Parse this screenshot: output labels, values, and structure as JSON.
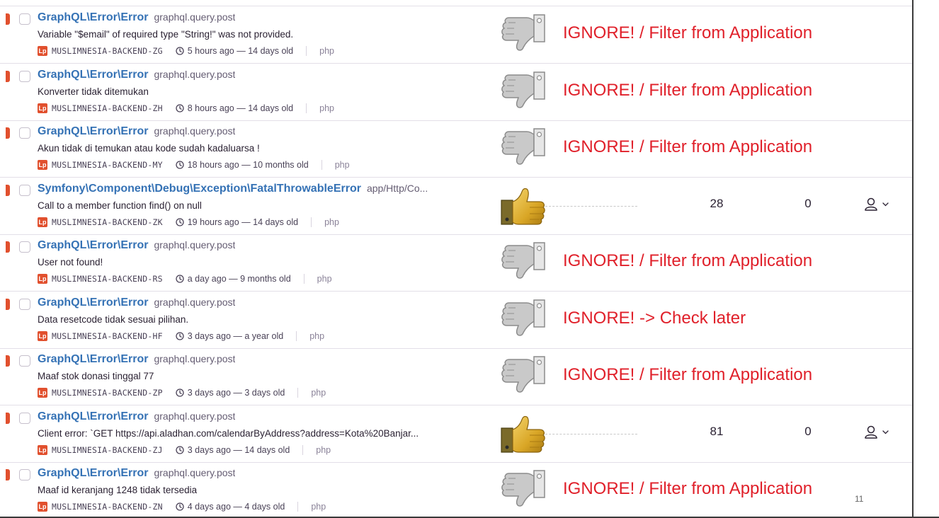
{
  "issues": [
    {
      "title": "GraphQL\\Error\\Error",
      "culprit": "graphql.query.post",
      "message": "Variable \"$email\" of required type \"String!\" was not provided.",
      "project_icon": "Lp",
      "short_id": "MUSLIMNESIA-BACKEND-ZG",
      "age": "5 hours ago — 14 days old",
      "platform": "php",
      "vote": "thumbs-down",
      "annotation": "IGNORE! / Filter from Application",
      "events": "",
      "users": ""
    },
    {
      "title": "GraphQL\\Error\\Error",
      "culprit": "graphql.query.post",
      "message": "Konverter tidak ditemukan",
      "project_icon": "Lp",
      "short_id": "MUSLIMNESIA-BACKEND-ZH",
      "age": "8 hours ago — 14 days old",
      "platform": "php",
      "vote": "thumbs-down",
      "annotation": "IGNORE! / Filter from Application",
      "events": "",
      "users": ""
    },
    {
      "title": "GraphQL\\Error\\Error",
      "culprit": "graphql.query.post",
      "message": "Akun tidak di temukan atau kode sudah kadaluarsa !",
      "project_icon": "Lp",
      "short_id": "MUSLIMNESIA-BACKEND-MY",
      "age": "18 hours ago — 10 months old",
      "platform": "php",
      "vote": "thumbs-down",
      "annotation": "IGNORE! / Filter from Application",
      "events": "",
      "users": ""
    },
    {
      "title": "Symfony\\Component\\Debug\\Exception\\FatalThrowableError",
      "culprit": "app/Http/Co...",
      "message": "Call to a member function find() on null",
      "project_icon": "Lp",
      "short_id": "MUSLIMNESIA-BACKEND-ZK",
      "age": "19 hours ago — 14 days old",
      "platform": "php",
      "vote": "thumbs-up",
      "annotation": "",
      "events": "28",
      "users": "0"
    },
    {
      "title": "GraphQL\\Error\\Error",
      "culprit": "graphql.query.post",
      "message": "User not found!",
      "project_icon": "Lp",
      "short_id": "MUSLIMNESIA-BACKEND-RS",
      "age": "a day ago — 9 months old",
      "platform": "php",
      "vote": "thumbs-down",
      "annotation": "IGNORE! / Filter from Application",
      "events": "",
      "users": ""
    },
    {
      "title": "GraphQL\\Error\\Error",
      "culprit": "graphql.query.post",
      "message": "Data resetcode tidak sesuai pilihan.",
      "project_icon": "Lp",
      "short_id": "MUSLIMNESIA-BACKEND-HF",
      "age": "3 days ago — a year old",
      "platform": "php",
      "vote": "thumbs-down",
      "annotation": "IGNORE! -> Check later",
      "events": "",
      "users": ""
    },
    {
      "title": "GraphQL\\Error\\Error",
      "culprit": "graphql.query.post",
      "message": "Maaf stok donasi tinggal 77",
      "project_icon": "Lp",
      "short_id": "MUSLIMNESIA-BACKEND-ZP",
      "age": "3 days ago — 3 days old",
      "platform": "php",
      "vote": "thumbs-down",
      "annotation": "IGNORE! / Filter from Application",
      "events": "",
      "users": ""
    },
    {
      "title": "GraphQL\\Error\\Error",
      "culprit": "graphql.query.post",
      "message": "Client error: `GET https://api.aladhan.com/calendarByAddress?address=Kota%20Banjar...",
      "project_icon": "Lp",
      "short_id": "MUSLIMNESIA-BACKEND-ZJ",
      "age": "3 days ago — 14 days old",
      "platform": "php",
      "vote": "thumbs-up",
      "annotation": "",
      "events": "81",
      "users": "0"
    },
    {
      "title": "GraphQL\\Error\\Error",
      "culprit": "graphql.query.post",
      "message": "Maaf id keranjang 1248 tidak tersedia",
      "project_icon": "Lp",
      "short_id": "MUSLIMNESIA-BACKEND-ZN",
      "age": "4 days ago — 4 days old",
      "platform": "php",
      "vote": "thumbs-down",
      "annotation": "IGNORE! / Filter from Application",
      "events": "",
      "users": ""
    }
  ],
  "page_number": "11",
  "colors": {
    "level": "#e1502e",
    "title": "#3572b5",
    "annotation": "#e0202a"
  }
}
